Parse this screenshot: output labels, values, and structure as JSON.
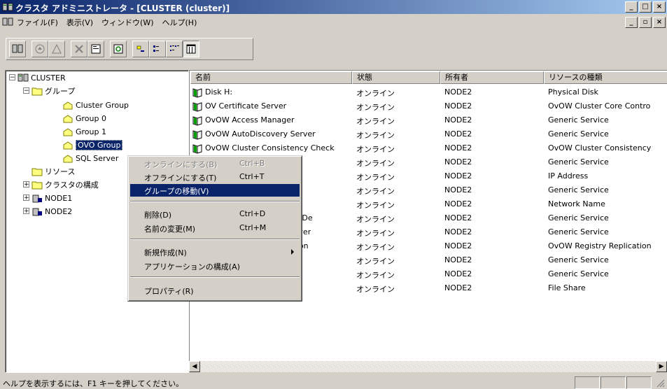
{
  "window": {
    "title": "クラスタ アドミニストレータ - [CLUSTER (cluster)]"
  },
  "menubar": {
    "items": [
      "ファイル(F)",
      "表示(V)",
      "ウィンドウ(W)",
      "ヘルプ(H)"
    ]
  },
  "tree": {
    "root": "CLUSTER",
    "groups": "グループ",
    "group_items": [
      "Cluster Group",
      "Group 0",
      "Group 1",
      "OVO Group",
      "SQL Server"
    ],
    "resources": "リソース",
    "cluster_config": "クラスタの構成",
    "nodes": [
      "NODE1",
      "NODE2"
    ]
  },
  "list": {
    "columns": [
      "名前",
      "状態",
      "所有者",
      "リソースの種類"
    ],
    "rows": [
      {
        "name": "Disk H:",
        "state": "オンライン",
        "owner": "NODE2",
        "type": "Physical Disk"
      },
      {
        "name": "OV Certificate Server",
        "state": "オンライン",
        "owner": "NODE2",
        "type": "OvOW Cluster Core Contro"
      },
      {
        "name": "OvOW Access Manager",
        "state": "オンライン",
        "owner": "NODE2",
        "type": "Generic Service"
      },
      {
        "name": "OvOW AutoDiscovery Server",
        "state": "オンライン",
        "owner": "NODE2",
        "type": "Generic Service"
      },
      {
        "name": "OvOW Cluster Consistency Check",
        "state": "オンライン",
        "owner": "NODE2",
        "type": "OvOW Cluster Consistency"
      },
      {
        "name": "",
        "state": "オンライン",
        "owner": "NODE2",
        "type": "Generic Service"
      },
      {
        "name": "",
        "state": "オンライン",
        "owner": "NODE2",
        "type": "IP Address"
      },
      {
        "name": "OvOW Action Server",
        "state": "オンライン",
        "owner": "NODE2",
        "type": "Generic Service"
      },
      {
        "name": "",
        "state": "オンライン",
        "owner": "NODE2",
        "type": "Network Name"
      },
      {
        "name": "OvOW Management and De",
        "state": "オンライン",
        "owner": "NODE2",
        "type": "Generic Service"
      },
      {
        "name": "OvOW Health Check Server",
        "state": "オンライン",
        "owner": "NODE2",
        "type": "Generic Service"
      },
      {
        "name": "OvOW Registry Replication",
        "state": "オンライン",
        "owner": "NODE2",
        "type": "OvOW Registry Replication"
      },
      {
        "name": "",
        "state": "オンライン",
        "owner": "NODE2",
        "type": "Generic Service"
      },
      {
        "name": "",
        "state": "オンライン",
        "owner": "NODE2",
        "type": "Generic Service"
      },
      {
        "name": "SPI-Share",
        "state": "オンライン",
        "owner": "NODE2",
        "type": "File Share"
      }
    ]
  },
  "context_menu": {
    "items": [
      {
        "label": "オンラインにする(B)",
        "accel": "Ctrl+B",
        "disabled": true
      },
      {
        "label": "オフラインにする(T)",
        "accel": "Ctrl+T"
      },
      {
        "label": "グループの移動(V)",
        "accel": "",
        "highlighted": true
      },
      {
        "label": "削除(D)",
        "accel": "Ctrl+D"
      },
      {
        "label": "名前の変更(M)",
        "accel": "Ctrl+M"
      },
      {
        "label": "新規作成(N)",
        "accel": "",
        "submenu": true
      },
      {
        "label": "アプリケーションの構成(A)",
        "accel": ""
      },
      {
        "label": "プロパティ(R)",
        "accel": ""
      }
    ]
  },
  "statusbar": {
    "text": "ヘルプを表示するには、F1 キーを押してください。"
  }
}
